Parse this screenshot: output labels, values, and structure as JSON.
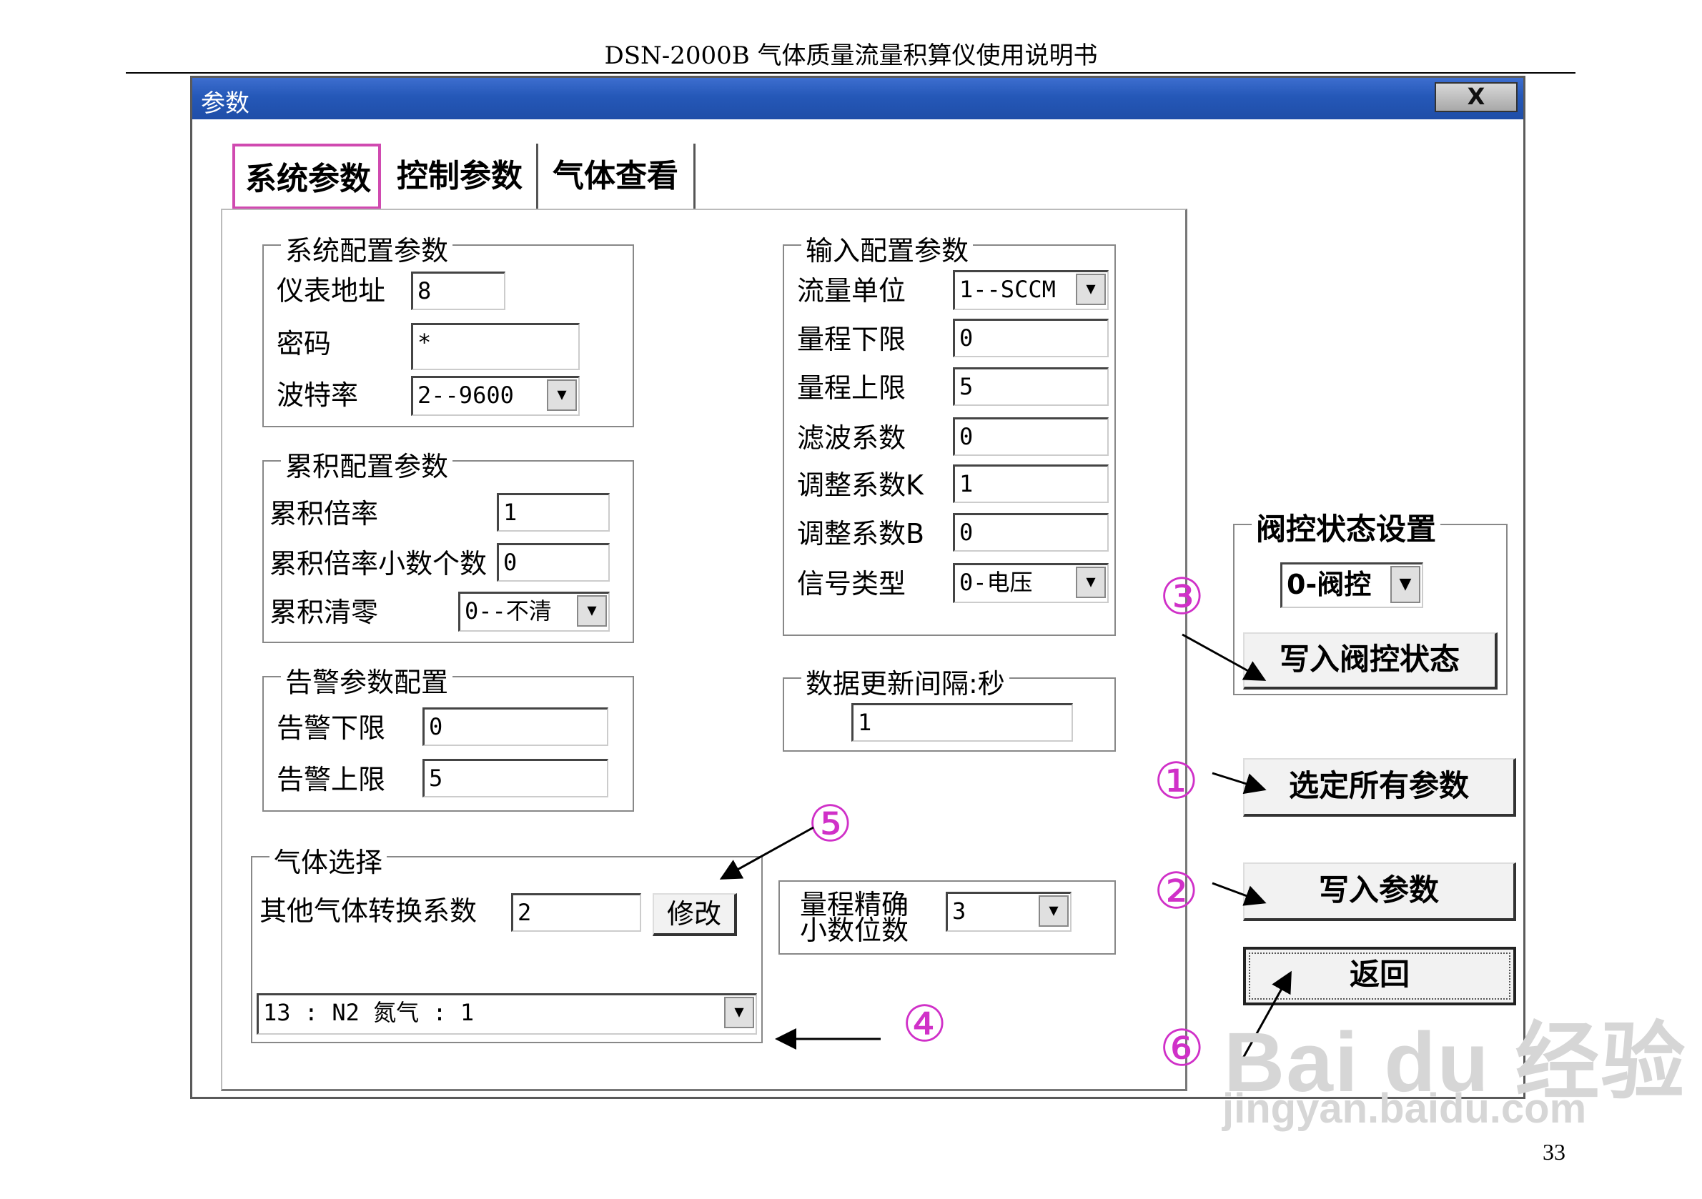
{
  "document": {
    "header": "DSN-2000B 气体质量流量积算仪使用说明书",
    "page_number": "33"
  },
  "window": {
    "title": "参数",
    "close_label": "X"
  },
  "tabs": [
    {
      "label": "系统参数",
      "active": true
    },
    {
      "label": "控制参数",
      "active": false
    },
    {
      "label": "气体查看",
      "active": false
    }
  ],
  "system_config": {
    "title": "系统配置参数",
    "address_label": "仪表地址",
    "address_value": "8",
    "password_label": "密码",
    "password_value": "*",
    "baud_label": "波特率",
    "baud_value": "2--9600"
  },
  "accum_config": {
    "title": "累积配置参数",
    "rate_label": "累积倍率",
    "rate_value": "1",
    "decimals_label": "累积倍率小数个数",
    "decimals_value": "0",
    "clear_label": "累积清零",
    "clear_value": "0--不清"
  },
  "alarm_config": {
    "title": "告警参数配置",
    "low_label": "告警下限",
    "low_value": "0",
    "high_label": "告警上限",
    "high_value": "5"
  },
  "gas_select": {
    "title": "气体选择",
    "factor_label": "其他气体转换系数",
    "factor_value": "2",
    "modify_label": "修改",
    "gas_value": "13  : N2 氮气        : 1"
  },
  "input_config": {
    "title": "输入配置参数",
    "unit_label": "流量单位",
    "unit_value": "1--SCCM",
    "range_low_label": "量程下限",
    "range_low_value": "0",
    "range_high_label": "量程上限",
    "range_high_value": "5",
    "filter_label": "滤波系数",
    "filter_value": "0",
    "adjust_k_label": "调整系数K",
    "adjust_k_value": "1",
    "adjust_b_label": "调整系数B",
    "adjust_b_value": "0",
    "signal_label": "信号类型",
    "signal_value": "0-电压"
  },
  "update_interval": {
    "title": "数据更新间隔:秒",
    "value": "1"
  },
  "precision": {
    "label_line1": "量程精确",
    "label_line2": "小数位数",
    "value": "3"
  },
  "valve": {
    "title": "阀控状态设置",
    "value": "0-阀控",
    "write_label": "写入阀控状态"
  },
  "buttons": {
    "select_all": "选定所有参数",
    "write_params": "写入参数",
    "back": "返回"
  },
  "annotations": [
    "①",
    "②",
    "③",
    "④",
    "⑤",
    "⑥"
  ],
  "watermark": {
    "logo": "Bai du 经验",
    "url": "jingyan.baidu.com"
  },
  "colors": {
    "titlebar": "#2558b8",
    "annotation": "#d030c8",
    "active_tab_border": "#d04ab0"
  }
}
